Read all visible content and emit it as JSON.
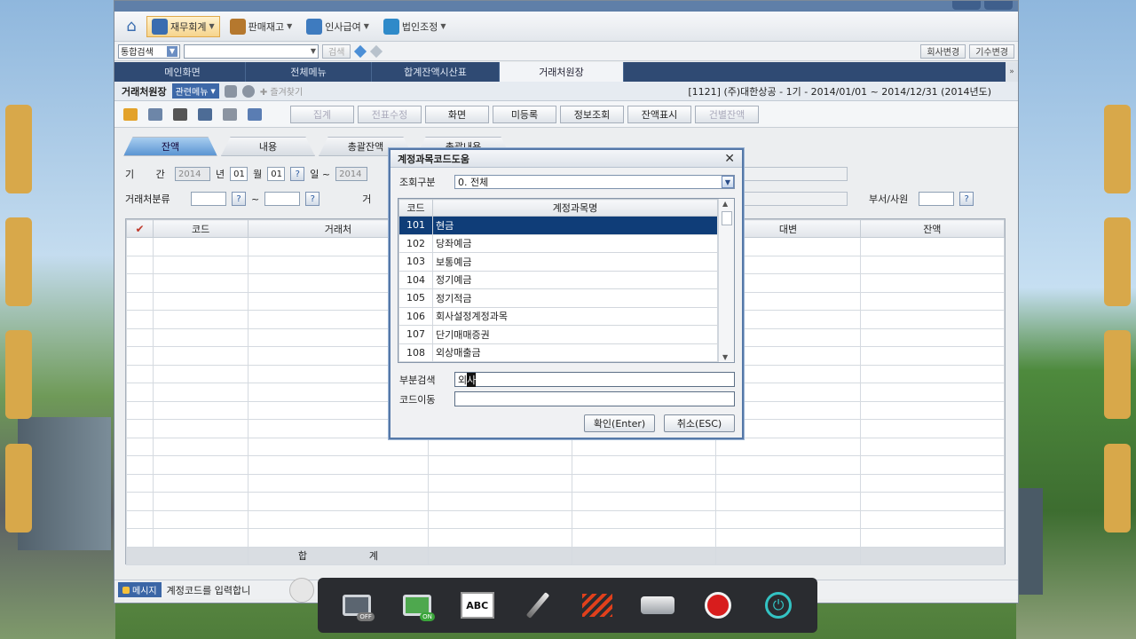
{
  "menubar": {
    "items": [
      {
        "label": "재무회계",
        "color": "#3a6db0",
        "active": true
      },
      {
        "label": "판매재고",
        "color": "#b5782e",
        "active": false
      },
      {
        "label": "인사급여",
        "color": "#3e7bbf",
        "active": false
      },
      {
        "label": "법인조정",
        "color": "#2f8ac9",
        "active": false
      }
    ]
  },
  "searchbar": {
    "scope": "통합검색",
    "query": "",
    "search_label": "검색",
    "company_change": "회사변경",
    "period_change": "기수변경"
  },
  "tabs": [
    "메인화면",
    "전체메뉴",
    "합계잔액시산표",
    "거래처원장"
  ],
  "subheader": {
    "title": "거래처원장",
    "related_menu": "관련메뉴",
    "favorite": "즐겨찾기",
    "company": "[1121] (주)대한상공 - 1기 - 2014/01/01 ~ 2014/12/31 (2014년도)"
  },
  "toolbar": {
    "buttons": [
      {
        "label": "집계",
        "disabled": true
      },
      {
        "label": "전표수정",
        "disabled": true
      },
      {
        "label": "화면",
        "disabled": false
      },
      {
        "label": "미등록",
        "disabled": false
      },
      {
        "label": "정보조회",
        "disabled": false
      },
      {
        "label": "잔액표시",
        "disabled": false
      },
      {
        "label": "건별잔액",
        "disabled": true
      }
    ]
  },
  "subtabs": [
    "잔액",
    "내용",
    "총괄잔액",
    "총괄내용"
  ],
  "filters": {
    "period_label": "기       간",
    "year": "2014",
    "year_unit": "년",
    "month_from": "01",
    "month_unit": "월",
    "day_from": "01",
    "day_unit": "일 ~",
    "year_to": "2014",
    "partner_class_label": "거래처분류",
    "range_sep": "~",
    "partner_label": "거",
    "partner_label_b": "래",
    "dept_label": "부서/사원"
  },
  "grid": {
    "columns": [
      "코드",
      "거래처",
      "",
      "",
      "대변",
      "잔액"
    ],
    "footer_a": "합",
    "footer_b": "계"
  },
  "status": {
    "label": "메시지",
    "text": "계정코드를 입력합니"
  },
  "dialog": {
    "title": "계정과목코드도움",
    "query_label": "조회구분",
    "query_value": "0. 전체",
    "col_code": "코드",
    "col_name": "계정과목명",
    "rows": [
      {
        "code": "101",
        "name": "현금"
      },
      {
        "code": "102",
        "name": "당좌예금"
      },
      {
        "code": "103",
        "name": "보통예금"
      },
      {
        "code": "104",
        "name": "정기예금"
      },
      {
        "code": "105",
        "name": "정기적금"
      },
      {
        "code": "106",
        "name": "회사설정계정과목"
      },
      {
        "code": "107",
        "name": "단기매매증권"
      },
      {
        "code": "108",
        "name": "외상매출금"
      }
    ],
    "partial_label": "부분검색",
    "partial_value_a": "외",
    "partial_value_b": "사",
    "codego_label": "코드이동",
    "ok": "확인(Enter)",
    "cancel": "취소(ESC)"
  },
  "overlay": {
    "abc": "ABC",
    "badge_off": "OFF",
    "badge_on": "ON"
  }
}
